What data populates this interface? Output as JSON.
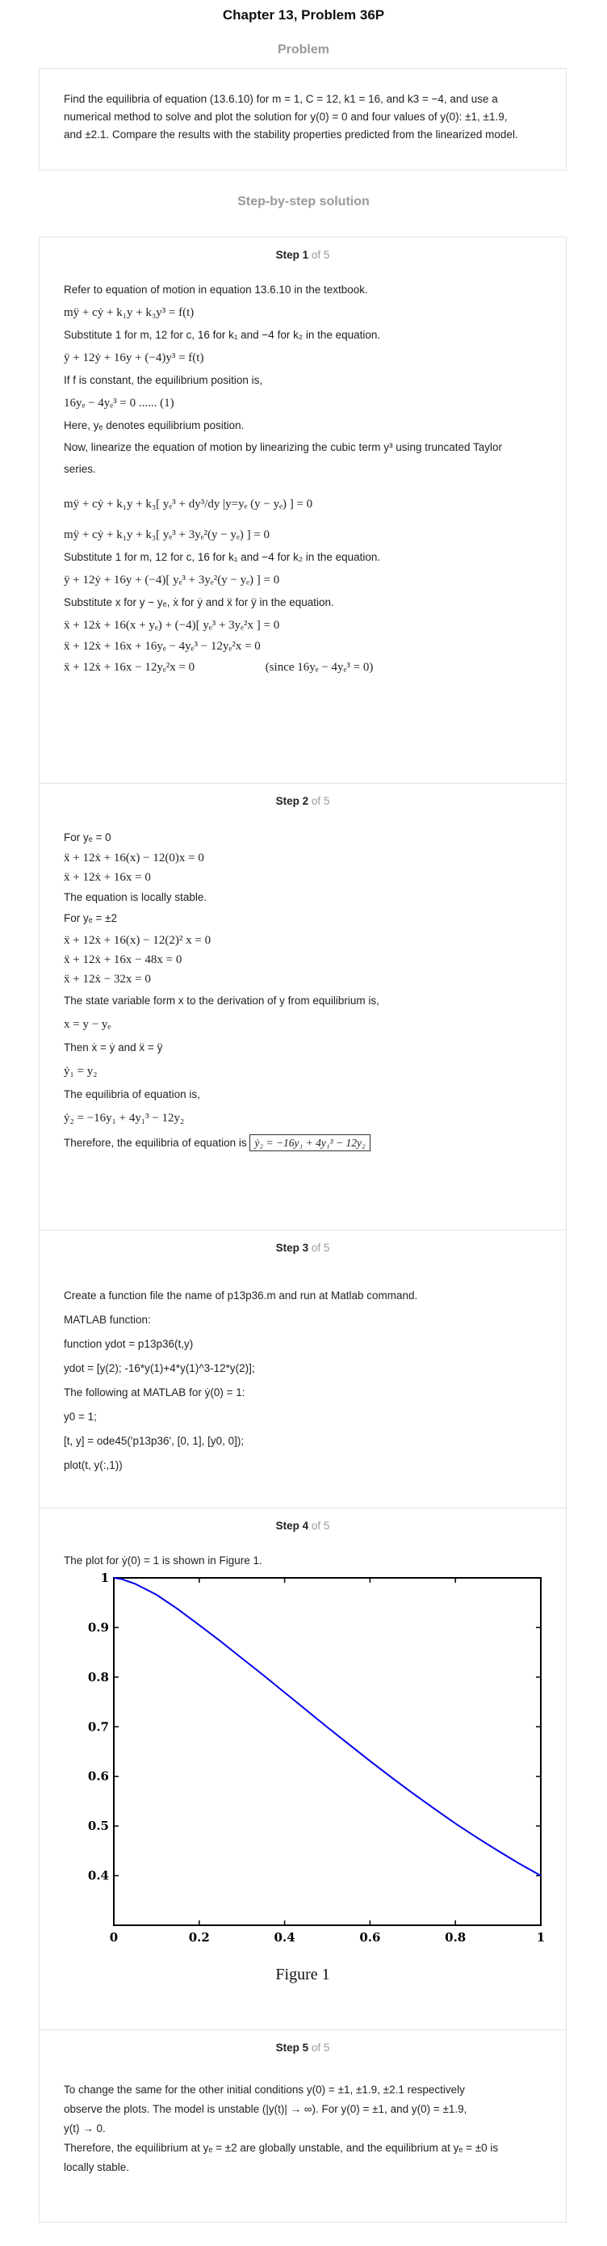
{
  "header": {
    "title": "Chapter 13, Problem 36P"
  },
  "problem": {
    "label": "Problem",
    "text_1": "Find the equilibria of equation (13.6.10) for m = 1, C = 12, k1 = 16, and k3 = −4, and use a",
    "text_2": "numerical method to solve and plot the solution for y(0) = 0 and four values of y(0): ±1, ±1.9,",
    "text_3": "and ±2.1. Compare the results with the stability properties predicted from the linearized model."
  },
  "solution": {
    "label": "Step-by-step solution"
  },
  "step_of": "of 5",
  "step1": {
    "head": "Step 1",
    "l1": "Refer to equation of motion in equation 13.6.10 in the textbook.",
    "e1": "mÿ + cẏ + k₁y + k₃y³ = f(t)",
    "l2": "Substitute 1 for m, 12 for c, 16 for k₁ and −4 for k₂ in the equation.",
    "e2": "ÿ + 12ẏ + 16y + (−4)y³ = f(t)",
    "l3": "If  f  is constant, the equilibrium position is,",
    "e3": "16yₑ − 4yₑ³ = 0 ...... (1)",
    "l4": "Here,  yₑ denotes equilibrium position.",
    "l5": "Now, linearize the equation of motion by linearizing the cubic term  y³ using truncated Taylor",
    "l6": "series.",
    "e4": "mÿ + cẏ + k₁y + k₃[ yₑ³ + dy³/dy |y=yₑ (y − yₑ) ] = 0",
    "e5": "mÿ + cẏ + k₁y + k₃[ yₑ³ + 3yₑ²(y − yₑ) ] = 0",
    "l7": "Substitute 1 for m, 12 for c, 16 for k₁ and −4 for k₂ in the equation.",
    "e6": "ÿ + 12ẏ + 16y + (−4)[ yₑ³ + 3yₑ²(y − yₑ) ] = 0",
    "l8": "Substitute  x for  y − yₑ,  ẋ for  ẏ and  ẍ for  ÿ in the equation.",
    "e7": "ẍ + 12ẋ + 16(x + yₑ) + (−4)[ yₑ³ + 3yₑ²x ] = 0",
    "e8": "ẍ + 12ẋ + 16x + 16yₑ − 4yₑ³ − 12yₑ²x = 0",
    "e9": "ẍ + 12ẋ + 16x − 12yₑ²x = 0",
    "e9note": "(since 16yₑ − 4yₑ³ = 0)"
  },
  "step2": {
    "head": "Step 2",
    "l1": "For  yₑ = 0",
    "e1": "ẍ + 12ẋ + 16(x) − 12(0)x = 0",
    "e2": "ẍ + 12ẋ + 16x = 0",
    "l2": "The equation is locally stable.",
    "l3": "For  yₑ = ±2",
    "e3": "ẍ + 12ẋ + 16(x) − 12(2)² x = 0",
    "e4": "ẍ + 12ẋ + 16x − 48x = 0",
    "e5": "ẍ + 12ẋ − 32x = 0",
    "l4": "The state variable form  x to the derivation of  y from equilibrium is,",
    "e6": "x = y − yₑ",
    "l5": "Then  ẋ = ẏ and  ẍ = ÿ",
    "e7": "ẏ₁ = y₂",
    "l6": "The equilibria of equation is,",
    "e8": "ẏ₂ = −16y₁ + 4y₁³ − 12y₂",
    "l7": "Therefore, the equilibria of equation is",
    "boxed": "ẏ₂ = −16y₁ + 4y₁³ − 12y₂"
  },
  "step3": {
    "head": "Step 3",
    "l1": "Create a function file the name of p13p36.m and run at Matlab command.",
    "l2": "MATLAB function:",
    "l3": "function ydot = p13p36(t,y)",
    "l4": "ydot = [y(2); -16*y(1)+4*y(1)^3-12*y(2)];",
    "l5": "The following at MATLAB for  ẏ(0) = 1:",
    "l6": "y0 = 1;",
    "l7": "[t, y] = ode45('p13p36', [0, 1], [y0, 0]);",
    "l8": "plot(t, y(:,1))"
  },
  "step4": {
    "head": "Step 4",
    "l1": "The plot for  ẏ(0) = 1 is shown in Figure 1.",
    "caption": "Figure 1"
  },
  "step5": {
    "head": "Step 5",
    "l1": "To change the same for the other initial conditions  y(0) = ±1,  ±1.9,  ±2.1 respectively",
    "l2": "observe the plots. The model is unstable  (|y(t)| → ∞). For  y(0) = ±1, and  y(0) = ±1.9,",
    "l3": "y(t) → 0.",
    "l4": "Therefore, the equilibrium at  yₑ = ±2 are globally unstable, and the equilibrium at  yₑ = ±0 is",
    "l5": "locally stable."
  },
  "chart_data": {
    "type": "line",
    "xlim": [
      0,
      1
    ],
    "ylim": [
      0.3,
      1
    ],
    "xticks": [
      "0",
      "0.2",
      "0.4",
      "0.6",
      "0.8",
      "1"
    ],
    "yticks": [
      "0.4",
      "0.5",
      "0.6",
      "0.7",
      "0.8",
      "0.9",
      "1"
    ],
    "grid": false,
    "line_color": "#0000ee",
    "x": [
      0,
      0.02,
      0.05,
      0.1,
      0.15,
      0.2,
      0.25,
      0.3,
      0.35,
      0.4,
      0.45,
      0.5,
      0.55,
      0.6,
      0.65,
      0.7,
      0.75,
      0.8,
      0.85,
      0.9,
      0.95,
      1.0
    ],
    "y": [
      1.0,
      0.997,
      0.988,
      0.966,
      0.937,
      0.905,
      0.872,
      0.838,
      0.804,
      0.769,
      0.734,
      0.699,
      0.665,
      0.631,
      0.598,
      0.566,
      0.535,
      0.505,
      0.477,
      0.45,
      0.424,
      0.4
    ]
  }
}
